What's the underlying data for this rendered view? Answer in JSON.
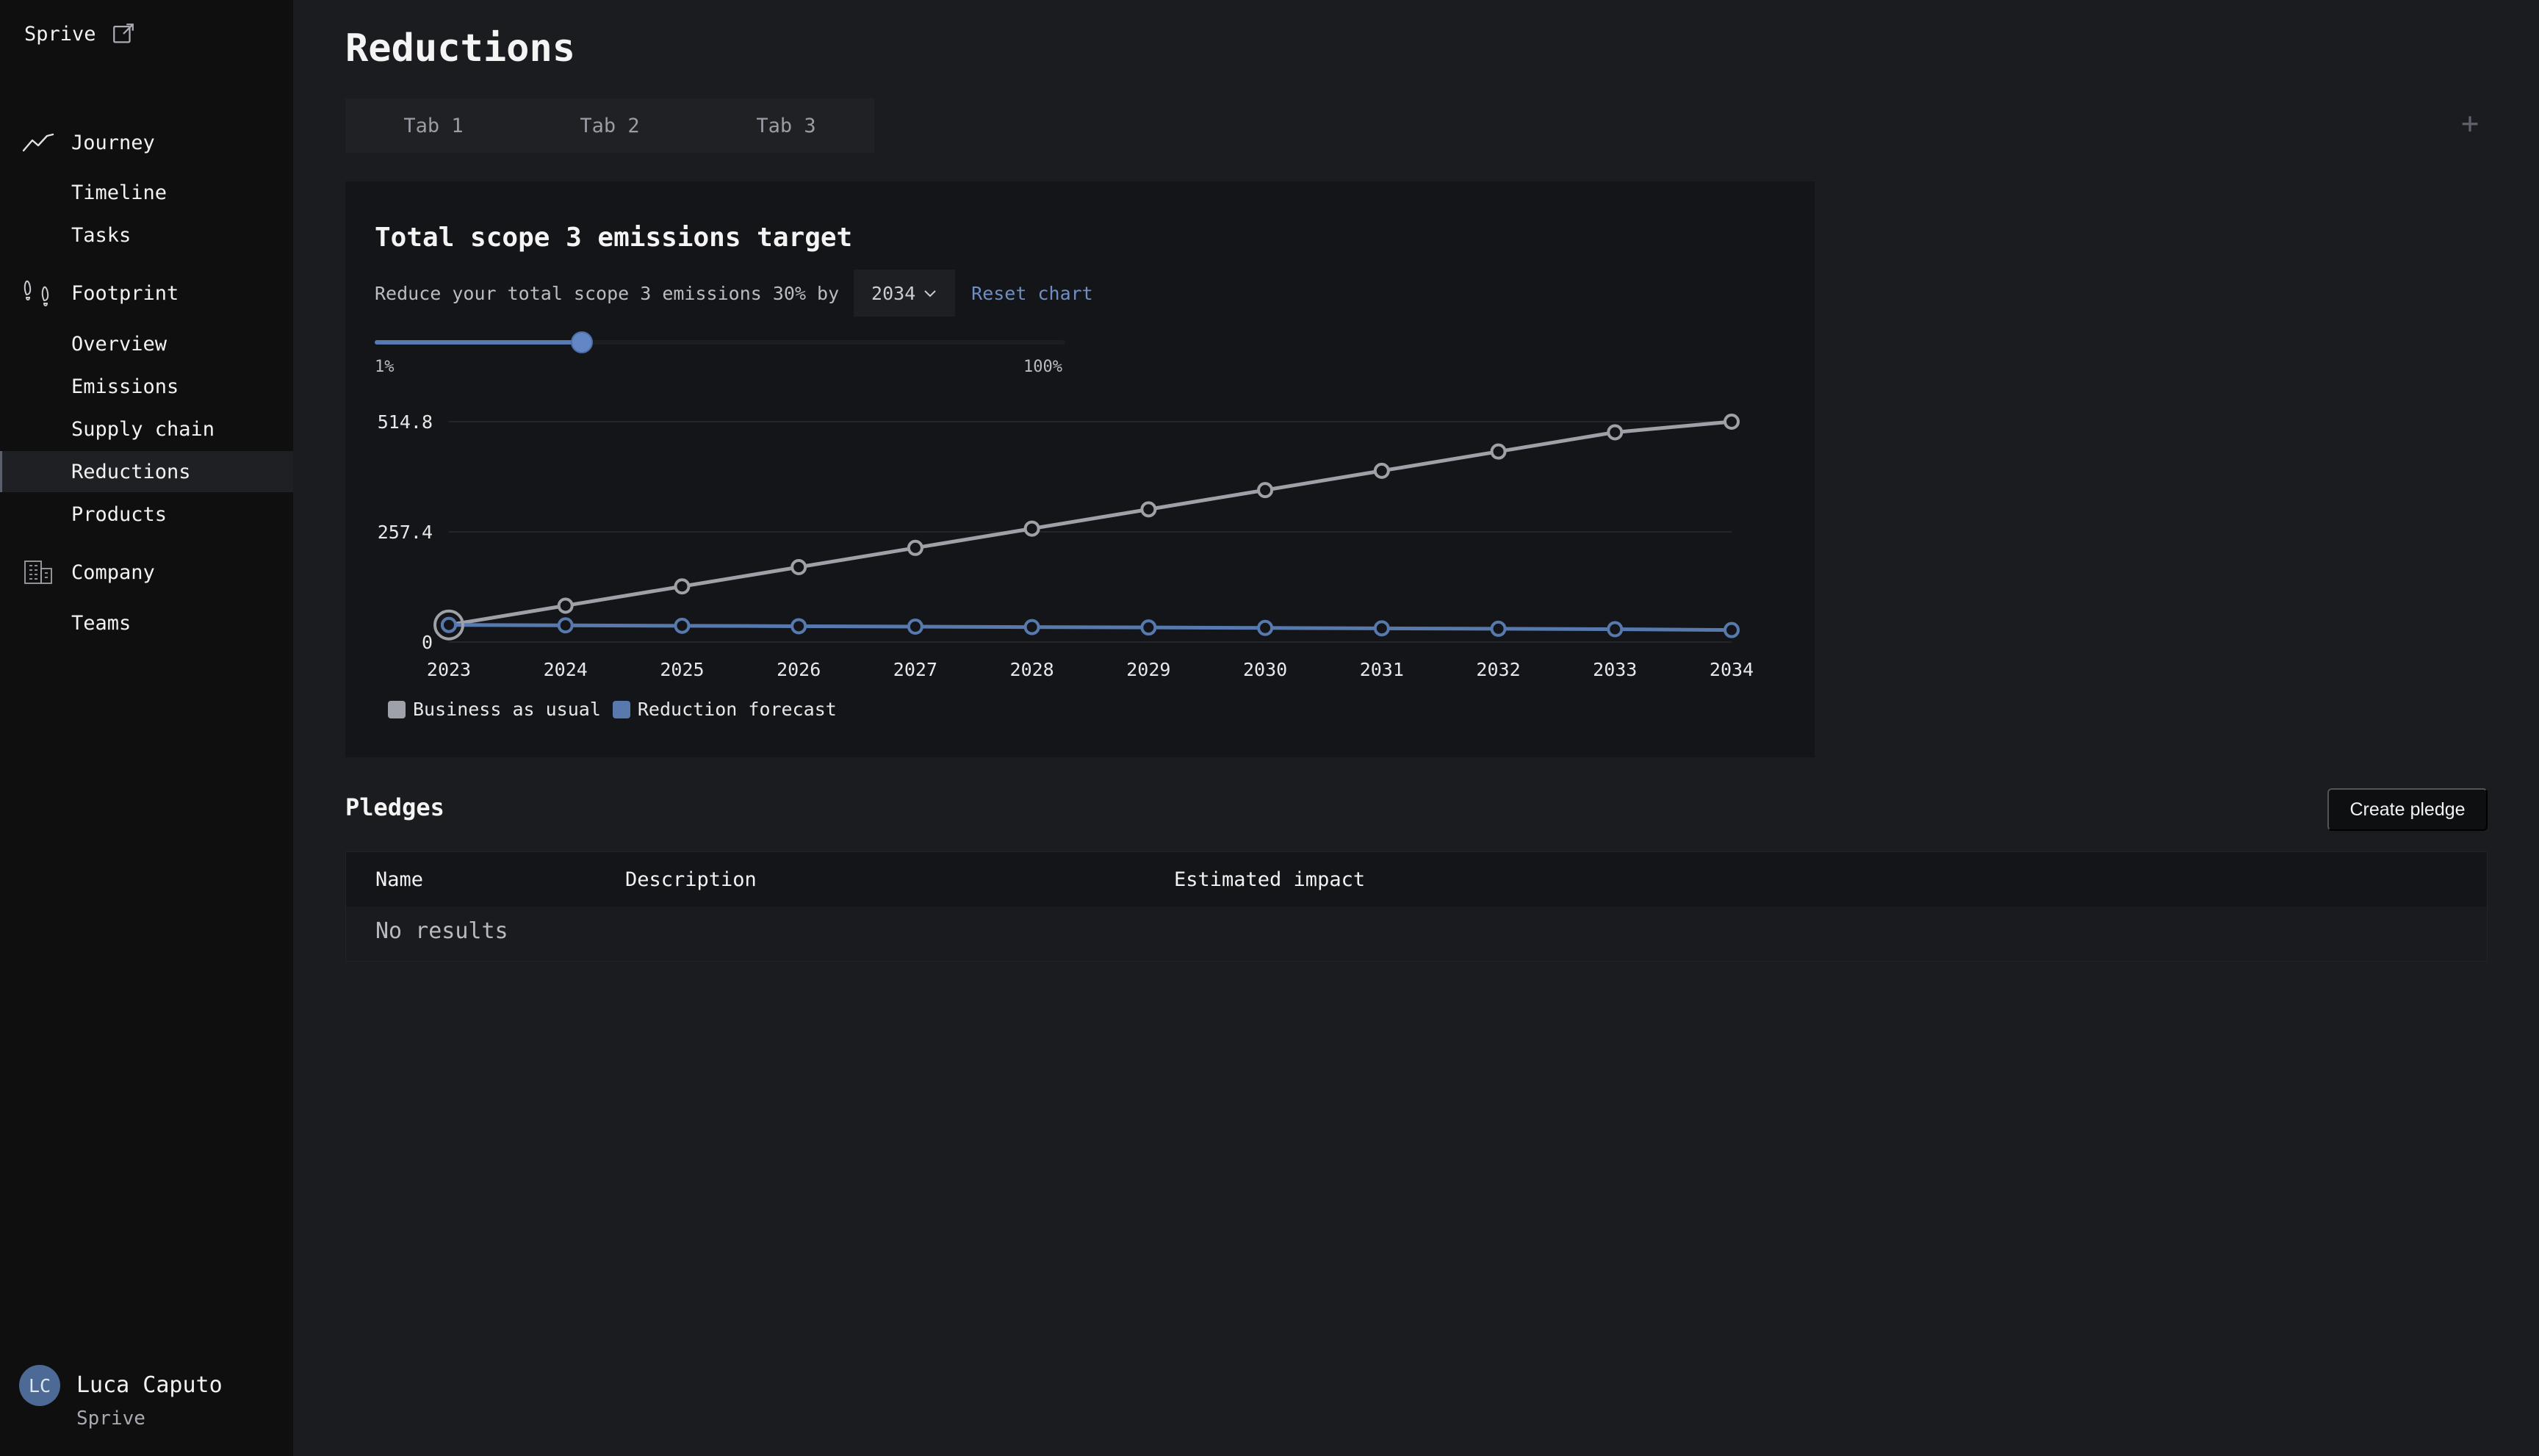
{
  "app": {
    "brand": "Sprive",
    "brand_icon": "external-link-icon"
  },
  "sidebar": {
    "groups": [
      {
        "label": "Journey",
        "icon": "trend-line-icon",
        "items": [
          {
            "label": "Timeline"
          },
          {
            "label": "Tasks"
          }
        ]
      },
      {
        "label": "Footprint",
        "icon": "footprints-icon",
        "items": [
          {
            "label": "Overview"
          },
          {
            "label": "Emissions"
          },
          {
            "label": "Supply chain"
          },
          {
            "label": "Reductions"
          },
          {
            "label": "Products"
          }
        ]
      },
      {
        "label": "Company",
        "icon": "building-icon",
        "items": [
          {
            "label": "Teams"
          }
        ]
      }
    ],
    "active_item": "Reductions"
  },
  "user": {
    "initials": "LC",
    "name": "Luca Caputo",
    "org": "Sprive"
  },
  "page": {
    "title": "Reductions",
    "tabs": [
      {
        "label": "Tab 1"
      },
      {
        "label": "Tab 2"
      },
      {
        "label": "Tab 3"
      }
    ],
    "add_tab_glyph": "+"
  },
  "target_card": {
    "title": "Total scope 3 emissions target",
    "sentence": "Reduce your total scope 3 emissions 30% by",
    "year_selected": "2034",
    "reset_label": "Reset chart",
    "slider": {
      "value_percent": 30,
      "min_label": "1%",
      "max_label": "100%"
    }
  },
  "chart_data": {
    "type": "line",
    "title": "",
    "xlabel": "",
    "ylabel": "",
    "x": [
      "2023",
      "2024",
      "2025",
      "2026",
      "2027",
      "2028",
      "2029",
      "2030",
      "2031",
      "2032",
      "2033",
      "2034"
    ],
    "yticks": [
      "0",
      "257.4",
      "514.8"
    ],
    "ylim": [
      0,
      514.8
    ],
    "series": [
      {
        "name": "Business as usual",
        "color": "#9ea1a8",
        "values": [
          40,
          85,
          130,
          175,
          220,
          265,
          310,
          355,
          400,
          445,
          490,
          514.8
        ]
      },
      {
        "name": "Reduction forecast",
        "color": "#5779ad",
        "values": [
          40,
          39,
          38,
          37,
          36,
          35,
          34,
          33,
          32,
          31,
          30,
          28
        ]
      }
    ],
    "grid": true,
    "legend_position": "bottom-left"
  },
  "pledges": {
    "title": "Pledges",
    "create_label": "Create pledge",
    "columns": [
      "Name",
      "Description",
      "Estimated impact"
    ],
    "empty_text": "No results"
  }
}
